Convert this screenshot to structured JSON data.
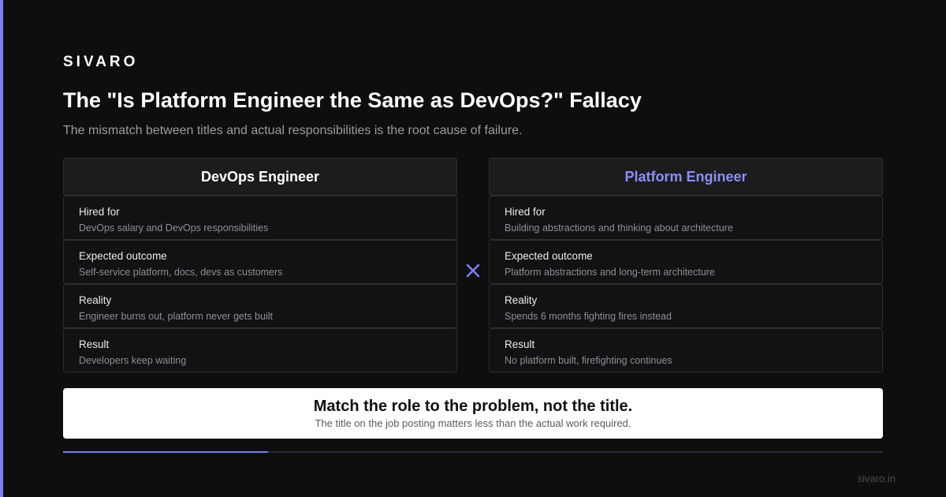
{
  "brand": "SIVARO",
  "title": "The \"Is Platform Engineer the Same as DevOps?\" Fallacy",
  "subtitle": "The mismatch between titles and actual responsibilities is the root cause of failure.",
  "columns": [
    {
      "header": "DevOps Engineer",
      "rows": [
        {
          "label": "Hired for",
          "value": "DevOps salary and DevOps responsibilities"
        },
        {
          "label": "Expected outcome",
          "value": "Self-service platform, docs, devs as customers"
        },
        {
          "label": "Reality",
          "value": "Engineer burns out, platform never gets built"
        },
        {
          "label": "Result",
          "value": "Developers keep waiting"
        }
      ]
    },
    {
      "header": "Platform Engineer",
      "rows": [
        {
          "label": "Hired for",
          "value": "Building abstractions and thinking about architecture"
        },
        {
          "label": "Expected outcome",
          "value": "Platform abstractions and long-term architecture"
        },
        {
          "label": "Reality",
          "value": "Spends 6 months fighting fires instead"
        },
        {
          "label": "Result",
          "value": "No platform built, firefighting continues"
        }
      ]
    }
  ],
  "callout": {
    "main": "Match the role to the problem, not the title.",
    "sub": "The title on the job posting matters less than the actual work required."
  },
  "progress": {
    "fraction": 0.25
  },
  "footer_url": "sivaro.in",
  "icons": {
    "divider": "cross-icon"
  },
  "colors": {
    "accent": "#7b7ff0",
    "platform_header": "#8b8ff5",
    "background": "#0e0e0f"
  }
}
